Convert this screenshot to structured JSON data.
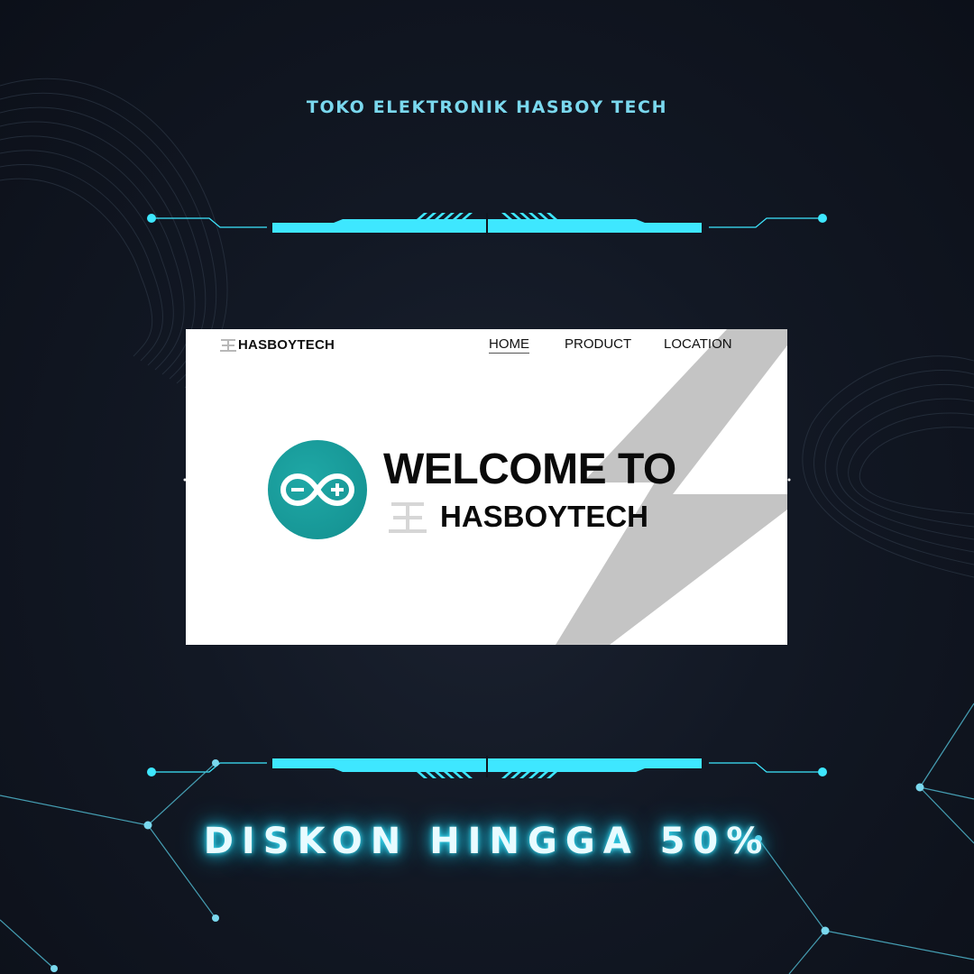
{
  "poster": {
    "shop_title": "TOKO ELEKTRONIK HASBOY TECH",
    "discount_text": "DISKON HINGGA 50%",
    "accent_color": "#3ee7ff",
    "background_color": "#0f141e"
  },
  "website": {
    "logo_text": "HASBOYTECH",
    "logo_icon": "king-glyph-icon",
    "nav": {
      "home": "HOME",
      "product": "PRODUCT",
      "location": "LOCATION"
    },
    "active_nav": "HOME",
    "hero": {
      "title": "WELCOME TO",
      "brand": "HASBOYTECH",
      "hero_icon": "arduino-infinity-icon",
      "hero_icon_color": "#17999a",
      "background_graphic": "lightning-bolt"
    }
  }
}
